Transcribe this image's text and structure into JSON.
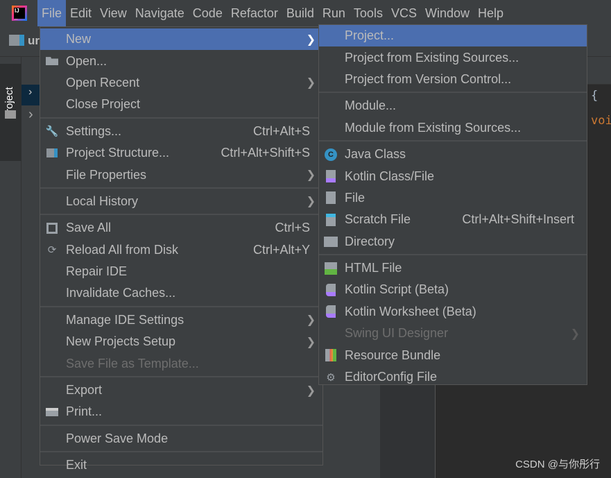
{
  "menubar": {
    "items": [
      {
        "label": "File",
        "active": true
      },
      {
        "label": "Edit"
      },
      {
        "label": "View"
      },
      {
        "label": "Navigate"
      },
      {
        "label": "Code"
      },
      {
        "label": "Refactor"
      },
      {
        "label": "Build"
      },
      {
        "label": "Run"
      },
      {
        "label": "Tools"
      },
      {
        "label": "VCS"
      },
      {
        "label": "Window"
      },
      {
        "label": "Help"
      }
    ]
  },
  "sidebar": {
    "tab_label": "Project",
    "breadcrumb_fragment": "ur"
  },
  "editor": {
    "code_brace": "{",
    "code_keyword": "voi",
    "keyword_color": "#cc7832"
  },
  "file_menu": {
    "items": [
      {
        "label": "New",
        "mn": "N",
        "submenu": true,
        "highlighted": true
      },
      {
        "label": "Open...",
        "mn": "O",
        "icon": "folder-open-icon"
      },
      {
        "label": "Open Recent",
        "mn": "R",
        "submenu": true
      },
      {
        "label": "Close Project"
      },
      {
        "sep": true
      },
      {
        "label": "Settings...",
        "mn": "t",
        "icon": "wrench-icon",
        "shortcut": "Ctrl+Alt+S"
      },
      {
        "label": "Project Structure...",
        "icon": "project-structure-icon",
        "shortcut": "Ctrl+Alt+Shift+S"
      },
      {
        "label": "File Properties",
        "submenu": true
      },
      {
        "sep": true
      },
      {
        "label": "Local History",
        "mn": "H",
        "submenu": true
      },
      {
        "sep": true
      },
      {
        "label": "Save All",
        "mn": "S",
        "icon": "save-icon",
        "shortcut": "Ctrl+S"
      },
      {
        "label": "Reload All from Disk",
        "icon": "reload-icon",
        "shortcut": "Ctrl+Alt+Y"
      },
      {
        "label": "Repair IDE"
      },
      {
        "label": "Invalidate Caches..."
      },
      {
        "sep": true
      },
      {
        "label": "Manage IDE Settings",
        "submenu": true
      },
      {
        "label": "New Projects Setup",
        "submenu": true
      },
      {
        "label": "Save File as Template...",
        "mn": "l",
        "disabled": true
      },
      {
        "sep": true
      },
      {
        "label": "Export",
        "submenu": true
      },
      {
        "label": "Print...",
        "mn": "P",
        "icon": "print-icon"
      },
      {
        "sep": true
      },
      {
        "label": "Power Save Mode"
      },
      {
        "sep": true
      },
      {
        "label": "Exit",
        "mn": "x"
      }
    ]
  },
  "new_submenu": {
    "items": [
      {
        "label": "Project...",
        "highlighted": true
      },
      {
        "label": "Project from Existing Sources..."
      },
      {
        "label": "Project from Version Control..."
      },
      {
        "sep": true
      },
      {
        "label": "Module..."
      },
      {
        "label": "Module from Existing Sources..."
      },
      {
        "sep": true
      },
      {
        "label": "Java Class",
        "icon": "java-class-icon"
      },
      {
        "label": "Kotlin Class/File",
        "icon": "kotlin-file-icon"
      },
      {
        "label": "File",
        "icon": "file-icon"
      },
      {
        "label": "Scratch File",
        "icon": "scratch-file-icon",
        "shortcut": "Ctrl+Alt+Shift+Insert"
      },
      {
        "label": "Directory",
        "icon": "folder-icon"
      },
      {
        "sep": true
      },
      {
        "label": "HTML File",
        "icon": "html-file-icon"
      },
      {
        "label": "Kotlin Script (Beta)",
        "icon": "kotlin-script-icon"
      },
      {
        "label": "Kotlin Worksheet (Beta)",
        "icon": "kotlin-worksheet-icon"
      },
      {
        "label": "Swing UI Designer",
        "submenu": true,
        "disabled": true
      },
      {
        "label": "Resource Bundle",
        "icon": "resource-bundle-icon"
      },
      {
        "label": "EditorConfig File",
        "icon": "gear-icon"
      }
    ]
  },
  "watermark": "CSDN @与你彤行"
}
